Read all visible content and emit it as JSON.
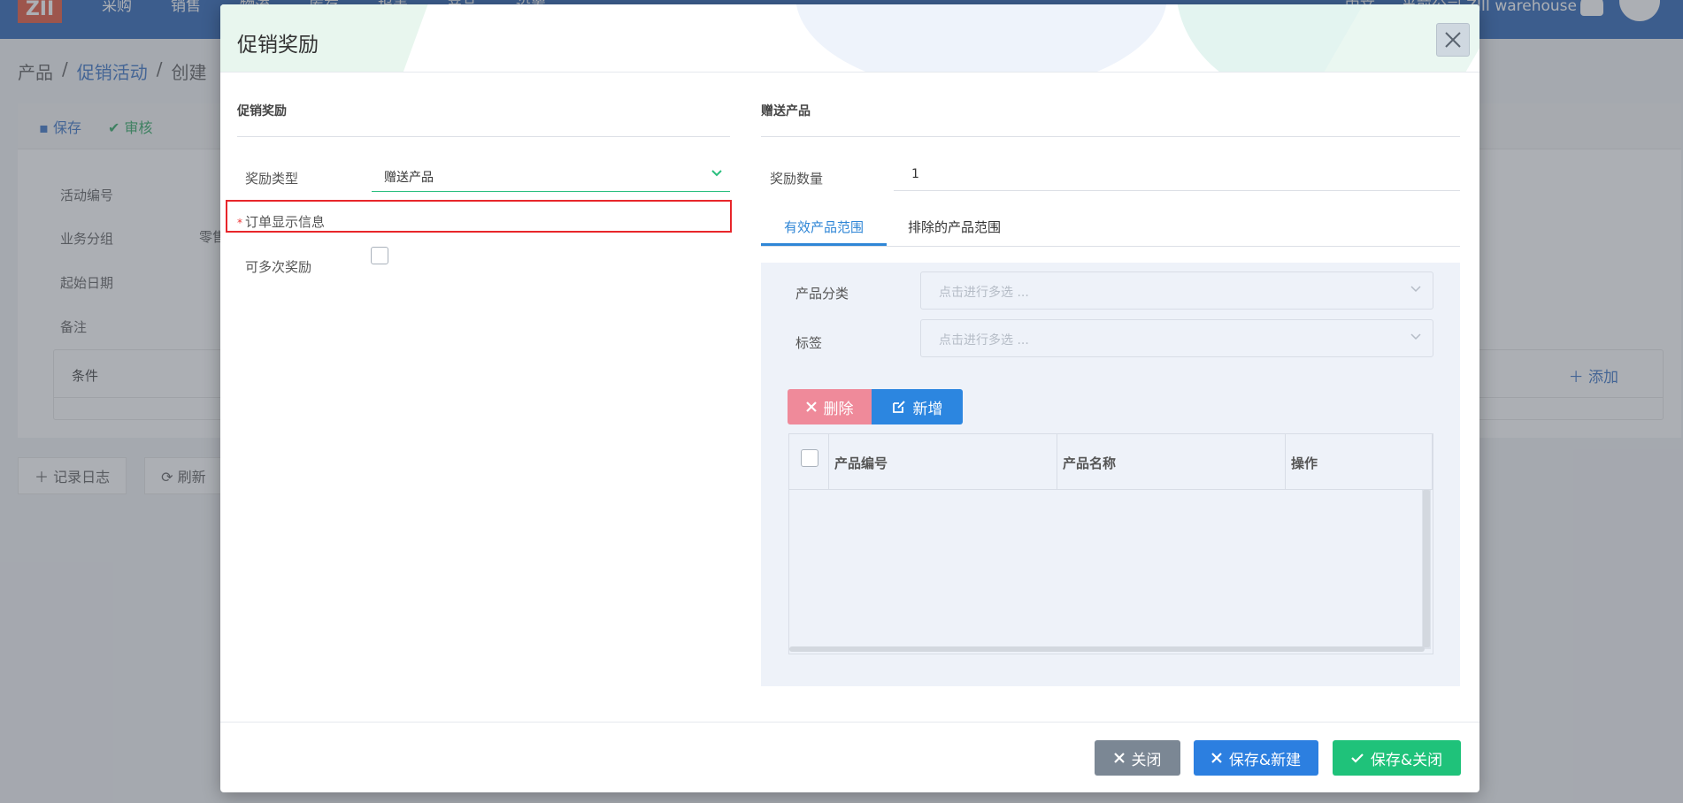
{
  "background": {
    "logo": "ZII",
    "nav": [
      "采购",
      "销售",
      "物流",
      "库存",
      "报表",
      "产品",
      "设置"
    ],
    "nav_right": [
      "中文",
      "当前公司 ZIII warehouse"
    ],
    "breadcrumb": [
      "产品",
      "促销活动",
      "创建"
    ],
    "toolbar": {
      "save": "保存",
      "audit": "审核"
    },
    "fields": [
      "活动编号",
      "业务分组",
      "起始日期",
      "备注"
    ],
    "field_value_group": "零售",
    "conditions_label": "条件",
    "add_label": "添加",
    "buttons": [
      "记录日志",
      "刷新"
    ]
  },
  "modal": {
    "title": "促销奖励",
    "left_section_title": "促销奖励",
    "reward_type_label": "奖励类型",
    "reward_type_value": "赠送产品",
    "order_display_label": "订单显示信息",
    "multi_reward_label": "可多次奖励",
    "right_section_title": "赠送产品",
    "reward_qty_label": "奖励数量",
    "reward_qty_value": "1",
    "tabs": [
      "有效产品范围",
      "排除的产品范围"
    ],
    "product_category_label": "产品分类",
    "tag_label": "标签",
    "multiselect_placeholder": "点击进行多选 ...",
    "delete_label": "删除",
    "new_label": "新增",
    "columns": [
      "产品编号",
      "产品名称",
      "操作"
    ],
    "footer": {
      "close": "关闭",
      "save_new": "保存&新建",
      "save_close": "保存&关闭"
    }
  },
  "colors": {
    "accent_blue": "#2c86e0",
    "success_green": "#1fc27a",
    "danger_red": "#e8262b"
  }
}
